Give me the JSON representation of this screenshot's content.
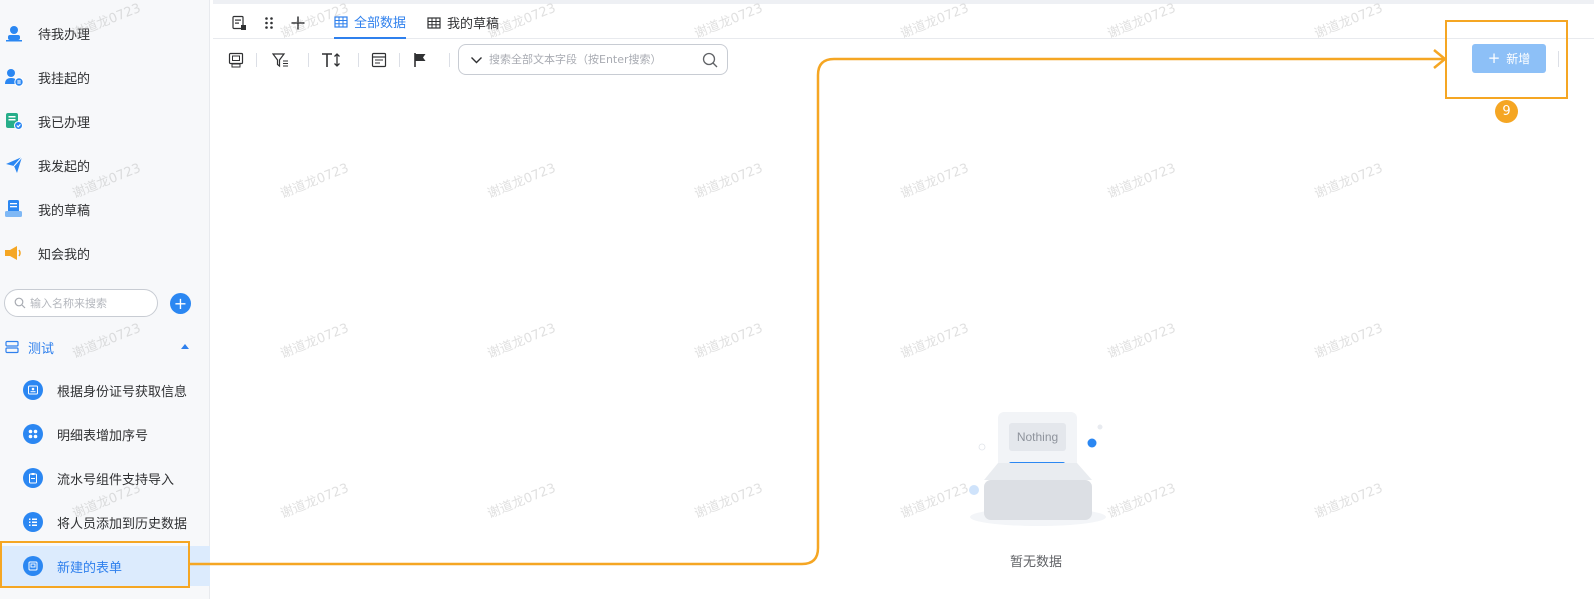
{
  "sidebar": {
    "menu": [
      {
        "label": "待我办理",
        "icon": "person-icon"
      },
      {
        "label": "我挂起的",
        "icon": "person-pause-icon"
      },
      {
        "label": "我已办理",
        "icon": "doc-check-icon"
      },
      {
        "label": "我发起的",
        "icon": "send-icon"
      },
      {
        "label": "我的草稿",
        "icon": "draft-icon"
      },
      {
        "label": "知会我的",
        "icon": "megaphone-icon"
      }
    ],
    "search_placeholder": "输入名称来搜索",
    "group": {
      "label": "测试"
    },
    "forms": [
      {
        "label": "根据身份证号获取信息"
      },
      {
        "label": "明细表增加序号"
      },
      {
        "label": "流水号组件支持导入"
      },
      {
        "label": "将人员添加到历史数据"
      },
      {
        "label": "新建的表单"
      }
    ]
  },
  "tabs": [
    {
      "label": "全部数据",
      "active": true
    },
    {
      "label": "我的草稿",
      "active": false
    }
  ],
  "toolbar": {
    "search_placeholder": "搜索全部文本字段（按Enter搜索）",
    "add_label": "新增"
  },
  "empty": {
    "illustration_text": "Nothing",
    "text": "暂无数据"
  },
  "annotation": {
    "badge": "9"
  },
  "watermark": "谢道龙0723",
  "colors": {
    "accent": "#2f80ed",
    "highlight": "#f5a623",
    "button": "#8dc0f7"
  }
}
